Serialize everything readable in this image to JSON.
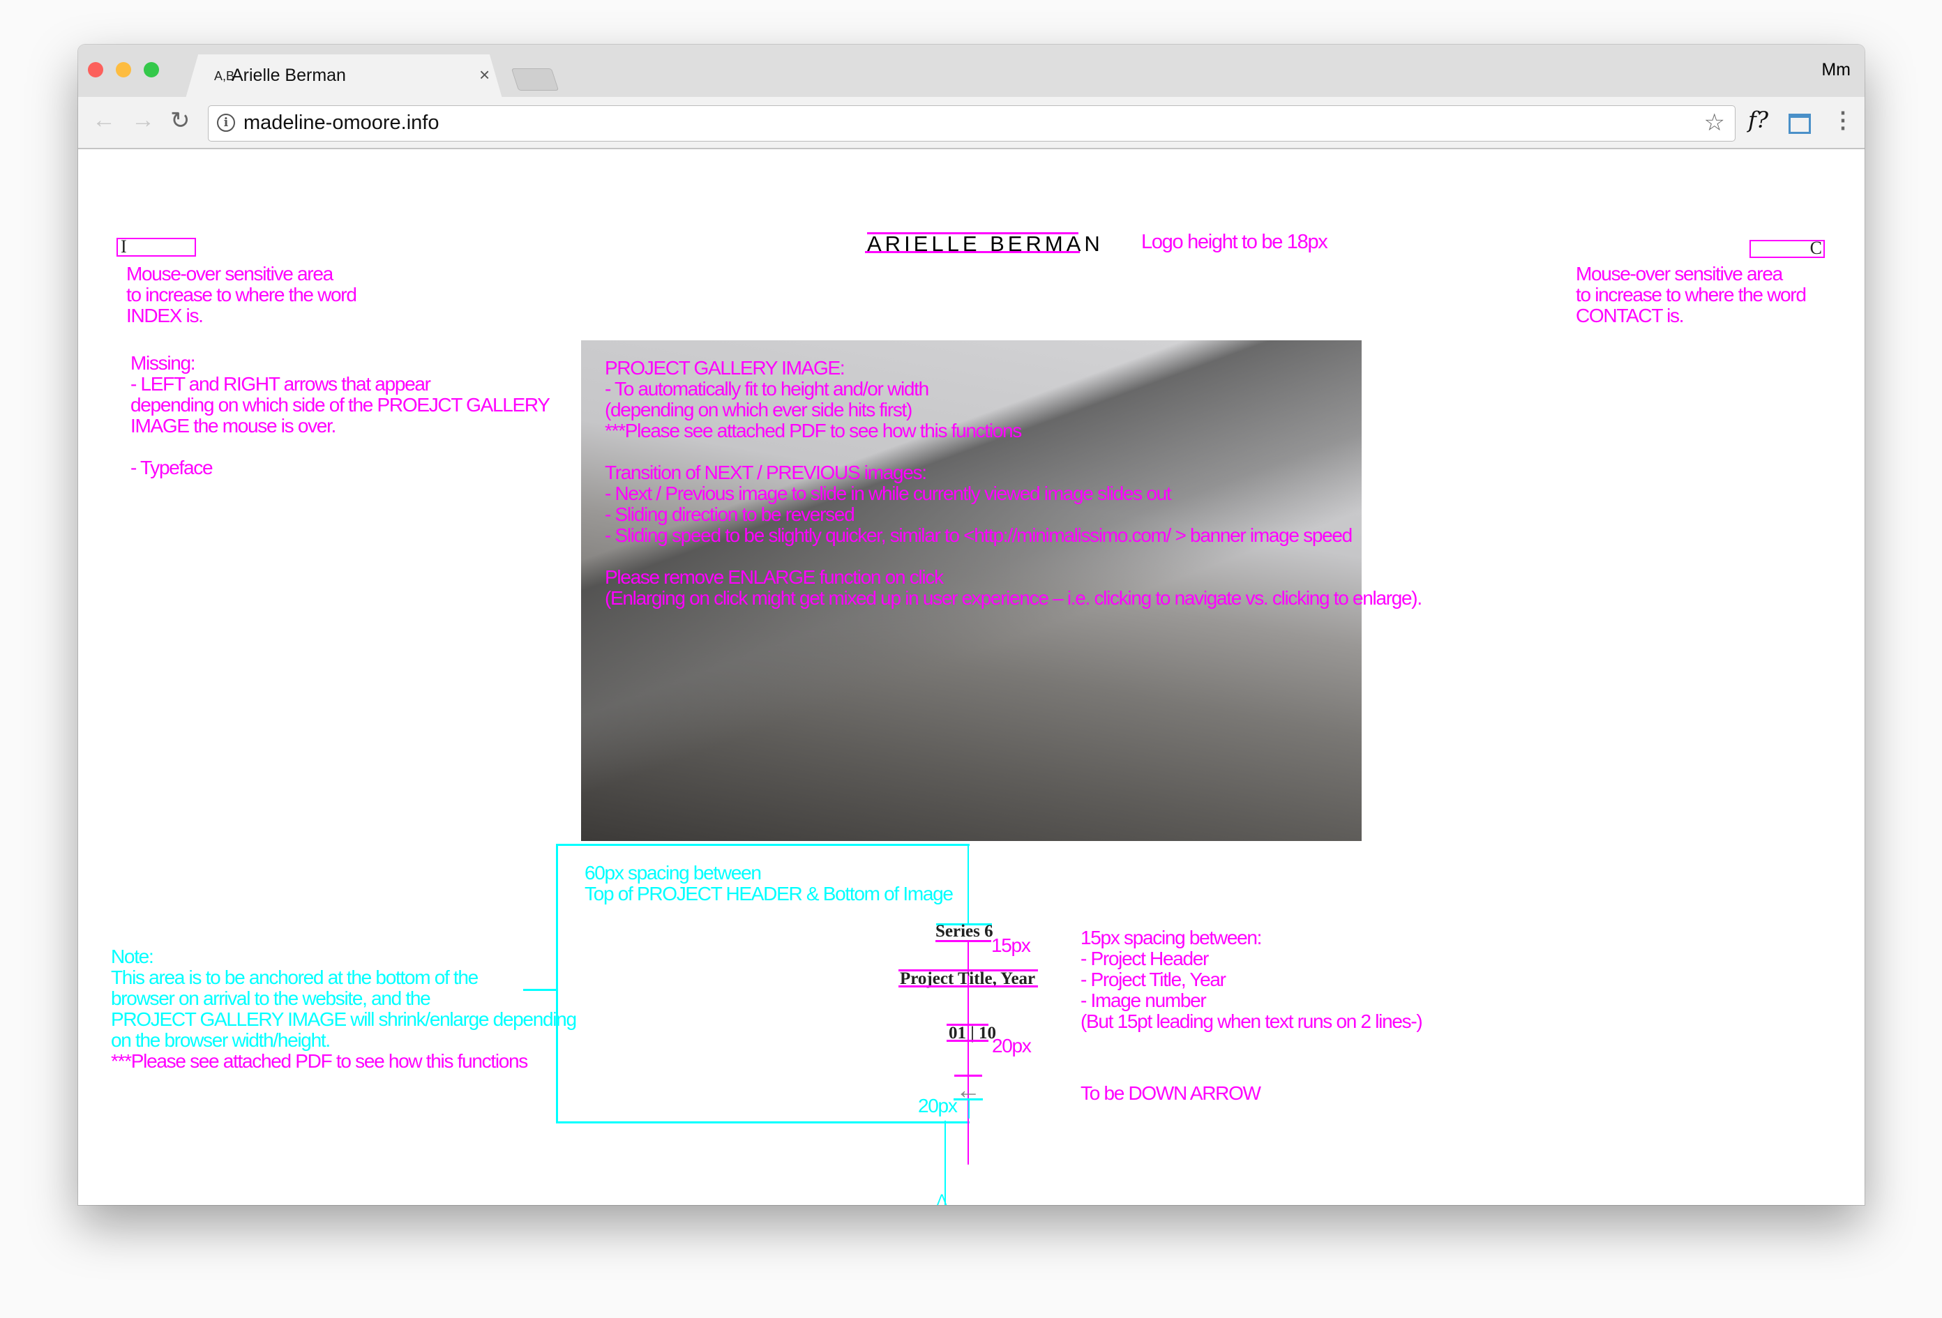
{
  "browser": {
    "tab": {
      "favicon_text": "A,B",
      "title": "Arielle Berman",
      "close": "×"
    },
    "profile": "Mm",
    "url": "madeline-omoore.info",
    "icons": [
      "back-arrow-icon",
      "forward-arrow-icon",
      "reload-icon",
      "info-icon",
      "star-icon",
      "font-finder-icon",
      "window-resizer-icon",
      "menu-icon"
    ],
    "extension_label": "f?"
  },
  "site": {
    "logo": "ARIELLE BERMAN",
    "index_link": "I",
    "contact_link": "C",
    "header": "Series 6",
    "project_title": "Project Title, Year",
    "image_counter": "01 | 10",
    "arrow": "←"
  },
  "annotations": {
    "logo_note": "Logo height to be 18px",
    "index_note": "Mouse-over sensitive area\nto increase to where the word\nINDEX is.",
    "contact_note": "Mouse-over sensitive area\nto increase to where the word\nCONTACT is.",
    "missing_note": "Missing:\n- LEFT and RIGHT arrows that appear\ndepending on which side of the PROEJCT GALLERY\nIMAGE the mouse is over.\n\n- Typeface",
    "gallery_note": "PROJECT GALLERY IMAGE:\n- To automatically fit to height and/or width\n(depending on which ever side hits first)\n***Please see attached PDF to see how this functions\n\nTransition of NEXT / PREVIOUS images:\n- Next / Previous image to slide in while currently viewed image slides out\n- Sliding direction to be reversed\n- Sliding speed to be slightly quicker, similar to <http://minimalissimo.com/ > banner image speed\n\nPlease remove ENLARGE function on click\n(Enlarging on click might get mixed up in user experience – i.e. clicking to navigate vs. clicking to enlarge).",
    "spacing_60_note": "60px spacing between\nTop of PROJECT HEADER & Bottom of Image",
    "spacing_15_label": "15px",
    "spacing_20_label": "20px",
    "spacing_20_bottom_label": "20px",
    "spacing_15_note": "15px spacing between:\n- Project Header\n- Project Title, Year\n- Image number\n(But 15pt leading when text runs on 2 lines-)",
    "down_arrow_note": "To be DOWN ARROW",
    "anchor_note": "Note:\nThis area is to be anchored at the bottom of the\nbrowser on arrival to the website, and the\nPROJECT GALLERY IMAGE will shrink/enlarge depending\non the browser width/height.",
    "pdf_note": "***Please see attached PDF to see how this functions"
  },
  "colors": {
    "magenta": "#ff00ff",
    "cyan": "#00ffff"
  }
}
